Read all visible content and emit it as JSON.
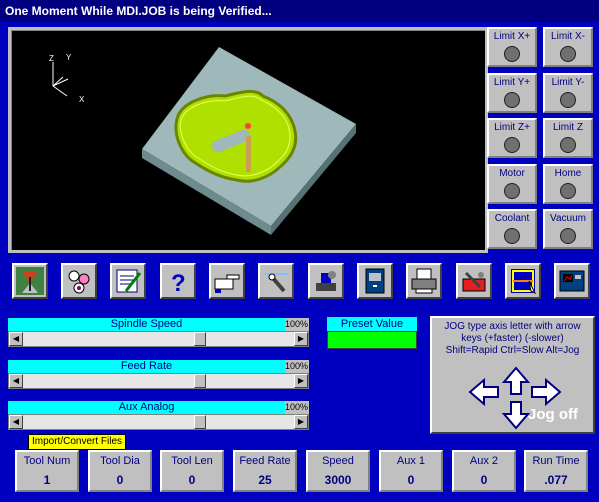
{
  "title": "One Moment While MDI.JOB is being Verified...",
  "viewport": {
    "axis_x": "X",
    "axis_y": "Y",
    "axis_z": "Z"
  },
  "limits": [
    {
      "label": "Limit X+"
    },
    {
      "label": "Limit X-"
    },
    {
      "label": "Limit Y+"
    },
    {
      "label": "Limit Y-"
    },
    {
      "label": "Limit Z+"
    },
    {
      "label": "Limit Z"
    },
    {
      "label": "Motor"
    },
    {
      "label": "Home"
    },
    {
      "label": "Coolant"
    },
    {
      "label": "Vacuum"
    }
  ],
  "toolbar_icons": [
    "tool-setup-icon",
    "tool-library-icon",
    "edit-document-icon",
    "help-icon",
    "pointing-hand-icon",
    "probe-icon",
    "machine-setup-icon",
    "file-cabinet-icon",
    "printer-icon",
    "toolbox-icon",
    "verify-icon",
    "controller-icon"
  ],
  "sliders": {
    "spindle": {
      "label": "Spindle Speed",
      "pct": "100%",
      "level": 0.66
    },
    "feed": {
      "label": "Feed Rate",
      "pct": "100%",
      "level": 0.66
    },
    "aux": {
      "label": "Aux Analog",
      "pct": "100%",
      "level": 0.66
    }
  },
  "preset": {
    "label": "Preset Value",
    "color": "#00ff00"
  },
  "jog": {
    "text": "JOG type axis letter with arrow keys (+faster) (-slower) Shift=Rapid Ctrl=Slow Alt=Jog",
    "status": "Jog off"
  },
  "tooltip": "Import/Convert Files",
  "status": [
    {
      "label": "Tool Num",
      "value": "1"
    },
    {
      "label": "Tool Dia",
      "value": "0"
    },
    {
      "label": "Tool Len",
      "value": "0"
    },
    {
      "label": "Feed Rate",
      "value": "25"
    },
    {
      "label": "Speed",
      "value": "3000"
    },
    {
      "label": "Aux 1",
      "value": "0"
    },
    {
      "label": "Aux 2",
      "value": "0"
    },
    {
      "label": "Run Time",
      "value": ".077"
    }
  ],
  "colors": {
    "background": "#0000c0",
    "title": "#000080",
    "slider_label": "#00ffff",
    "part_top": "#9fb8ba",
    "pocket": "#b0e000"
  }
}
